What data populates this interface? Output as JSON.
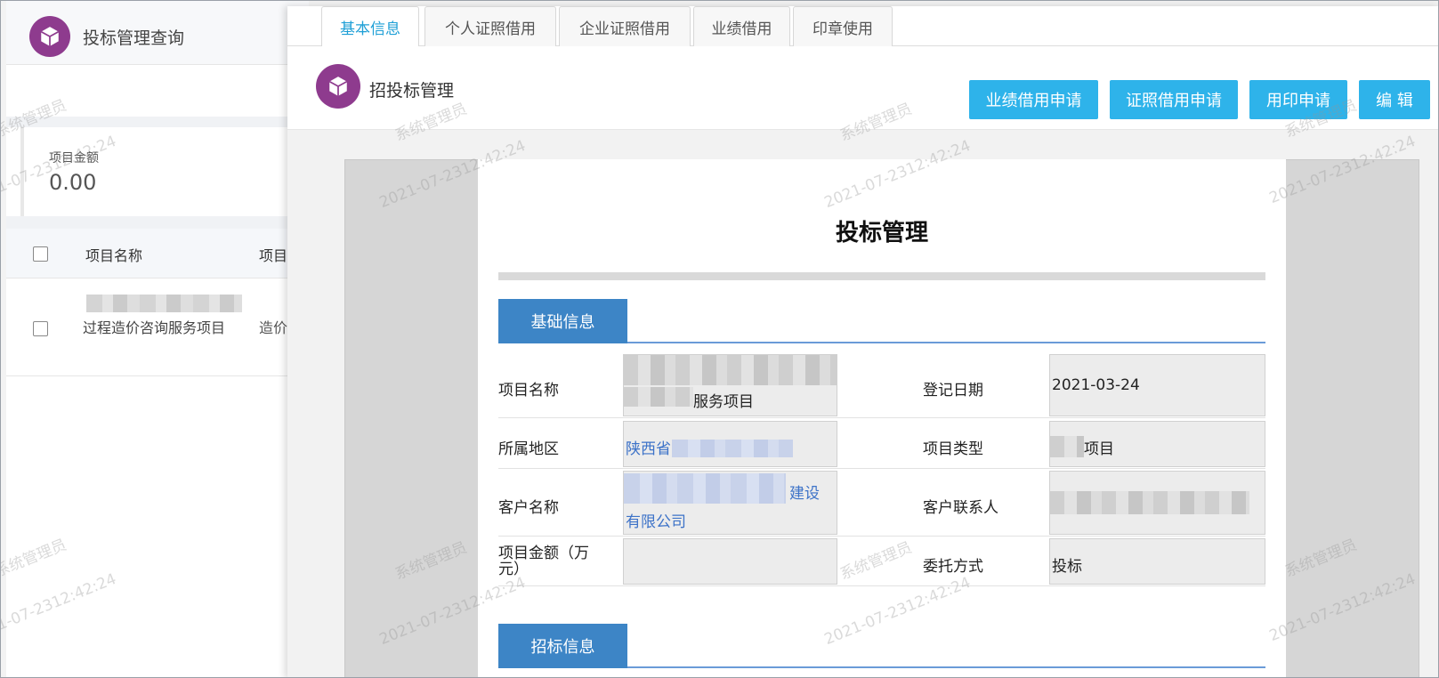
{
  "left_app": {
    "title": "投标管理查询",
    "amount_label": "项目金额",
    "amount_value": "0.00",
    "table": {
      "headers": [
        "项目名称",
        "项目"
      ],
      "rows": [
        {
          "name": "过程造价咨询服务项目",
          "type": "造价"
        }
      ]
    }
  },
  "panel": {
    "tabs": [
      "基本信息",
      "个人证照借用",
      "企业证照借用",
      "业绩借用",
      "印章使用"
    ],
    "active_tab": "基本信息",
    "header_title": "招投标管理",
    "buttons": {
      "performance_borrow": "业绩借用申请",
      "license_borrow": "证照借用申请",
      "seal_apply": "用印申请",
      "edit": "编 辑"
    }
  },
  "document": {
    "title": "投标管理",
    "section_basic": "基础信息",
    "section_bidding": "招标信息",
    "fields": {
      "project_name_label": "项目名称",
      "project_name_value_tail": "服务项目",
      "register_date_label": "登记日期",
      "register_date_value": "2021-03-24",
      "region_label": "所属地区",
      "region_value": "陕西省",
      "project_type_label": "项目类型",
      "project_type_value": "项目",
      "customer_name_label": "客户名称",
      "customer_name_value_tail": "建设",
      "customer_name_value_line2": "有限公司",
      "customer_contact_label": "客户联系人",
      "project_amount_label": "项目金额（万元）",
      "delegation_label": "委托方式",
      "delegation_value": "投标"
    }
  },
  "watermark": {
    "user": "系统管理员",
    "timestamp": "2021-07-2312:42:24"
  },
  "colors": {
    "brand_purple": "#8e3b8e",
    "button_blue": "#2eb3ea",
    "tab_active": "#1e9fd6",
    "section_blue": "#3d85c6",
    "link_blue": "#3c72c8"
  },
  "icons": [
    "cube-logo-icon"
  ]
}
